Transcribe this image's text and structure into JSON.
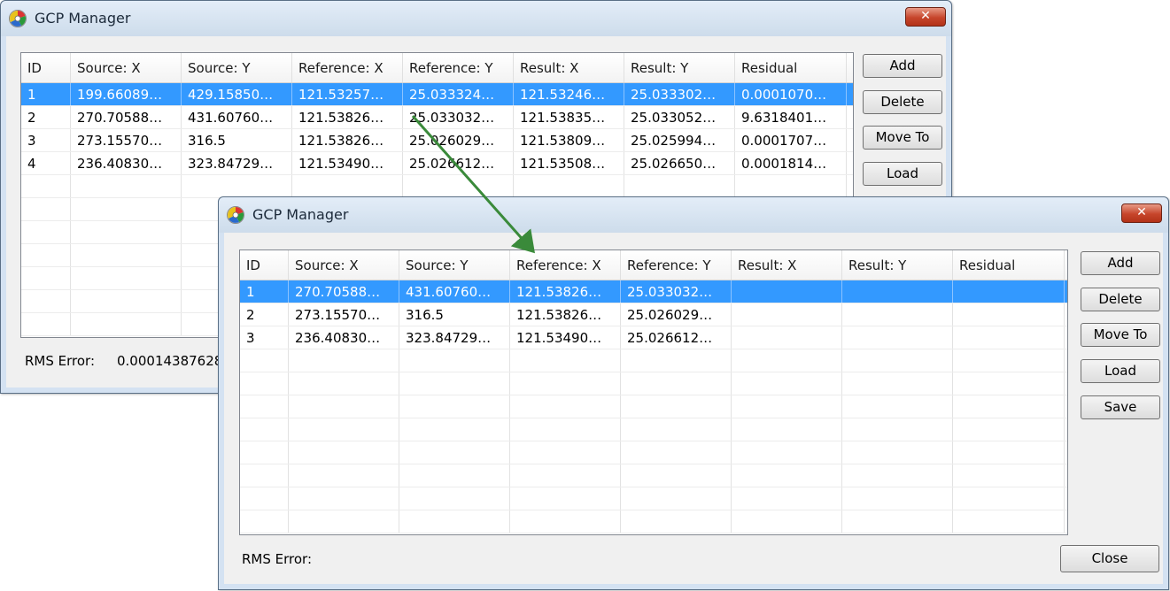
{
  "back_window": {
    "title": "GCP Manager",
    "close_glyph": "✕",
    "columns": [
      "ID",
      "Source: X",
      "Source: Y",
      "Reference: X",
      "Reference: Y",
      "Result: X",
      "Result: Y",
      "Residual"
    ],
    "rows": [
      [
        "1",
        "199.66089…",
        "429.15850…",
        "121.53257…",
        "25.033324…",
        "121.53246…",
        "25.033302…",
        "0.0001070…"
      ],
      [
        "2",
        "270.70588…",
        "431.60760…",
        "121.53826…",
        "25.033032…",
        "121.53835…",
        "25.033052…",
        "9.6318401…"
      ],
      [
        "3",
        "273.15570…",
        "316.5",
        "121.53826…",
        "25.026029…",
        "121.53809…",
        "25.025994…",
        "0.0001707…"
      ],
      [
        "4",
        "236.40830…",
        "323.84729…",
        "121.53490…",
        "25.026612…",
        "121.53508…",
        "25.026650…",
        "0.0001814…"
      ]
    ],
    "selected_row": 0,
    "buttons": {
      "add": "Add",
      "delete": "Delete",
      "move_to": "Move To",
      "load": "Load"
    },
    "rms_label": "RMS Error:",
    "rms_value": "0.00014387628"
  },
  "front_window": {
    "title": "GCP Manager",
    "close_glyph": "✕",
    "columns": [
      "ID",
      "Source: X",
      "Source: Y",
      "Reference: X",
      "Reference: Y",
      "Result: X",
      "Result: Y",
      "Residual"
    ],
    "rows": [
      [
        "1",
        "270.70588…",
        "431.60760…",
        "121.53826…",
        "25.033032…",
        "",
        "",
        ""
      ],
      [
        "2",
        "273.15570…",
        "316.5",
        "121.53826…",
        "25.026029…",
        "",
        "",
        ""
      ],
      [
        "3",
        "236.40830…",
        "323.84729…",
        "121.53490…",
        "25.026612…",
        "",
        "",
        ""
      ]
    ],
    "selected_row": 0,
    "buttons": {
      "add": "Add",
      "delete": "Delete",
      "move_to": "Move To",
      "load": "Load",
      "save": "Save",
      "close": "Close"
    },
    "rms_label": "RMS Error:"
  },
  "colors": {
    "selection": "#3399ff",
    "arrow": "#3a8a3a",
    "close_button": "#c6452b"
  },
  "icons": {
    "app": "gcp-app-icon",
    "close": "close-icon",
    "arrow": "annotation-arrow"
  }
}
